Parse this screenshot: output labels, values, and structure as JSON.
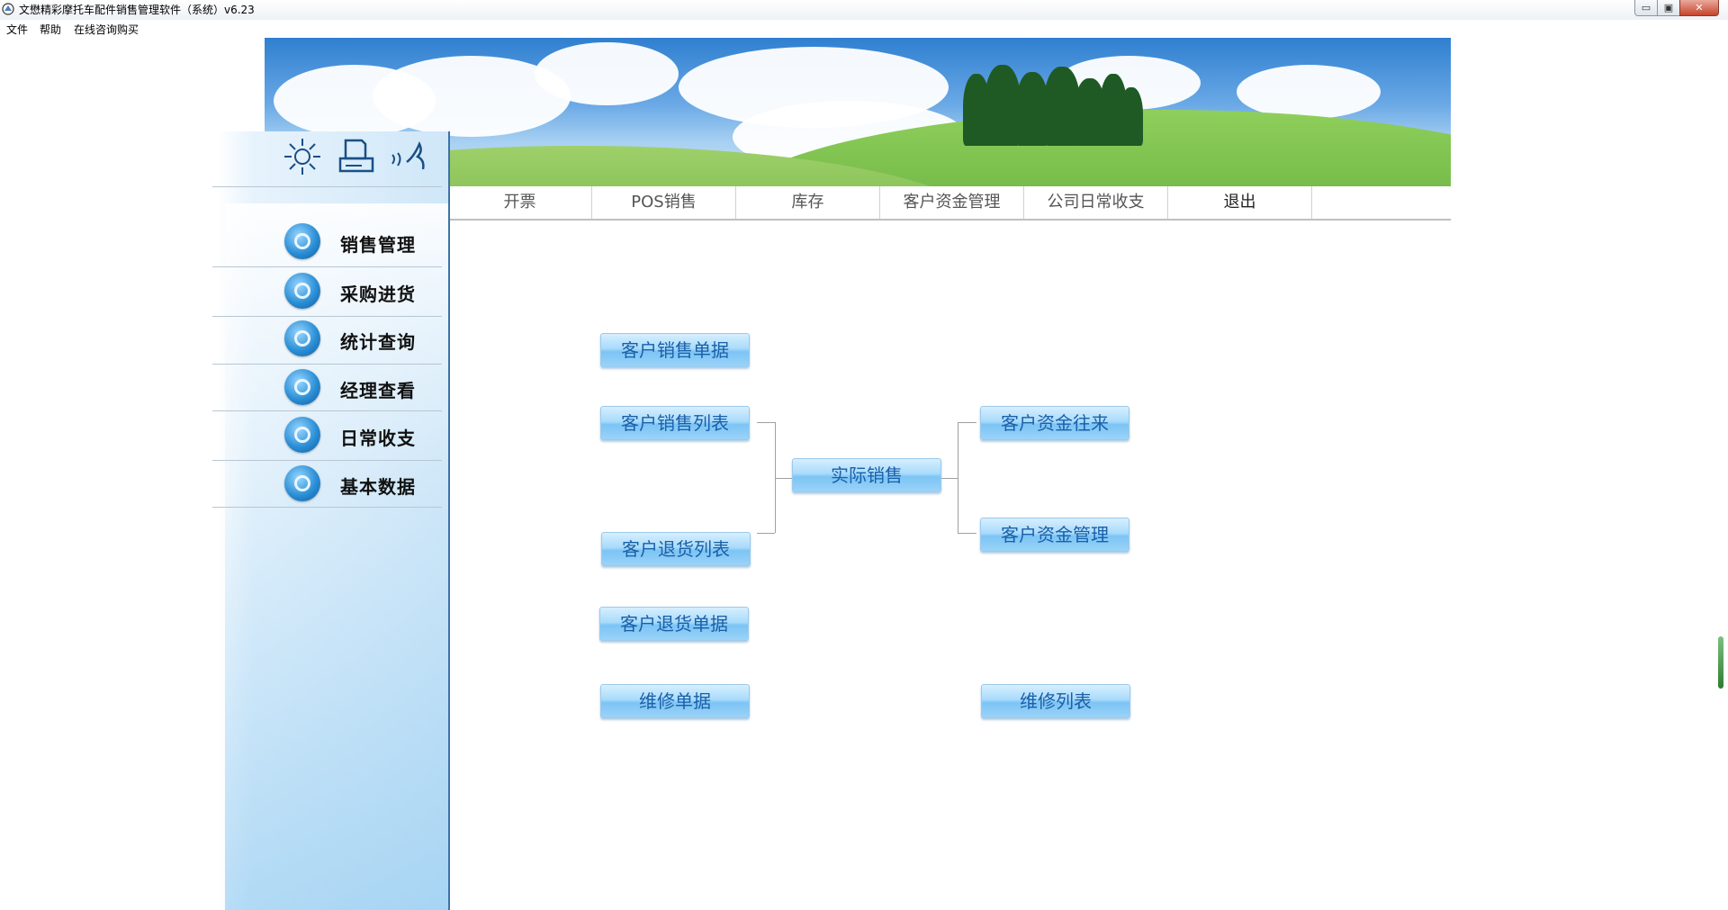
{
  "window": {
    "title": "文懋精彩摩托车配件销售管理软件（系统）v6.23",
    "minimize_label": "▭",
    "maximize_label": "▣",
    "close_label": "✕"
  },
  "menubar": {
    "items": [
      "文件",
      "帮助",
      "在线咨询购买"
    ]
  },
  "nav": {
    "tabs": [
      "开票",
      "POS销售",
      "库存",
      "客户资金管理",
      "公司日常收支",
      "退出"
    ]
  },
  "sidebar": {
    "tool_icons": [
      "sun-icon",
      "printer-icon",
      "calculator-icon"
    ],
    "items": [
      {
        "label": "销售管理",
        "icon": "leaf-orb-icon"
      },
      {
        "label": "采购进货",
        "icon": "recycle-orb-icon"
      },
      {
        "label": "统计查询",
        "icon": "layers-orb-icon"
      },
      {
        "label": "经理查看",
        "icon": "gear-orb-icon"
      },
      {
        "label": "日常收支",
        "icon": "gears-orb-icon"
      },
      {
        "label": "基本数据",
        "icon": "gear-orb-icon"
      }
    ]
  },
  "flow": {
    "customer_sales_doc": "客户销售单据",
    "customer_sales_list": "客户销售列表",
    "actual_sales": "实际销售",
    "customer_fund_transactions": "客户资金往来",
    "customer_return_list": "客户退货列表",
    "customer_fund_management": "客户资金管理",
    "customer_return_doc": "客户退货单据",
    "repair_doc": "维修单据",
    "repair_list": "维修列表"
  },
  "colors": {
    "accent": "#1a5fa8",
    "panel_border": "#3b73a8",
    "button_mid": "#7cc4f5"
  }
}
